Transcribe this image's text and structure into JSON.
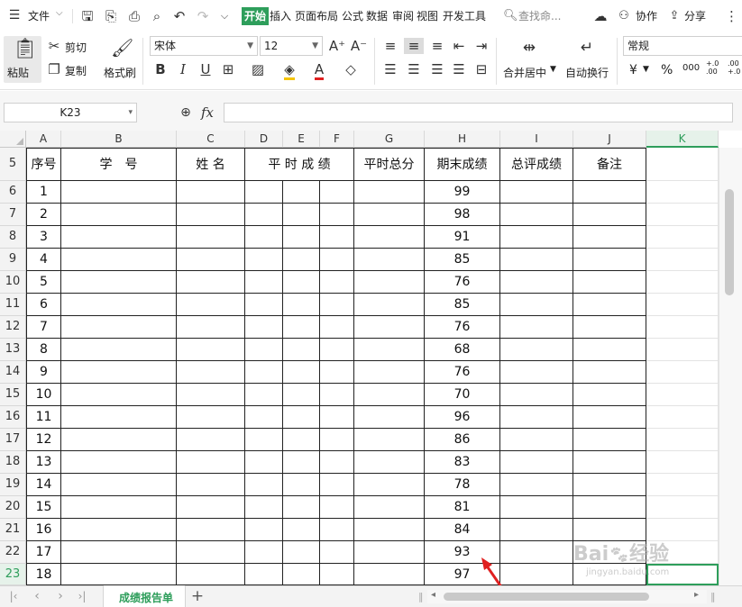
{
  "menu": {
    "file_label": "文件",
    "tabs": [
      "开始",
      "插入",
      "页面布局",
      "公式",
      "数据",
      "审阅",
      "视图",
      "开发工具"
    ],
    "search_placeholder": "查找命...",
    "collab_label": "协作",
    "share_label": "分享"
  },
  "ribbon": {
    "paste_label": "粘贴",
    "cut_label": "剪切",
    "copy_label": "复制",
    "format_painter_label": "格式刷",
    "font_name": "宋体",
    "font_size": "12",
    "merge_label": "合并居中",
    "wrap_label": "自动换行",
    "number_format": "常规",
    "currency_symbol": "¥",
    "percent_symbol": "%",
    "thousands_symbol": "000",
    "inc_decimal": "+.0 .00",
    "dec_decimal": ".00 +.0"
  },
  "formula_bar": {
    "name_box": "K23",
    "fx_label": "fx"
  },
  "columns": [
    "A",
    "B",
    "C",
    "D",
    "E",
    "F",
    "G",
    "H",
    "I",
    "J",
    "K"
  ],
  "header_row": {
    "row_num": "5",
    "seq": "序号",
    "student_id": "学　号",
    "name": "姓 名",
    "regular": "平 时 成 绩",
    "regular_total": "平时总分",
    "final": "期末成绩",
    "overall": "总评成绩",
    "note": "备注"
  },
  "rows": [
    {
      "row": "6",
      "seq": "1",
      "final": "99"
    },
    {
      "row": "7",
      "seq": "2",
      "final": "98"
    },
    {
      "row": "8",
      "seq": "3",
      "final": "91"
    },
    {
      "row": "9",
      "seq": "4",
      "final": "85"
    },
    {
      "row": "10",
      "seq": "5",
      "final": "76"
    },
    {
      "row": "11",
      "seq": "6",
      "final": "85"
    },
    {
      "row": "12",
      "seq": "7",
      "final": "76"
    },
    {
      "row": "13",
      "seq": "8",
      "final": "68"
    },
    {
      "row": "14",
      "seq": "9",
      "final": "76"
    },
    {
      "row": "15",
      "seq": "10",
      "final": "70"
    },
    {
      "row": "16",
      "seq": "11",
      "final": "96"
    },
    {
      "row": "17",
      "seq": "12",
      "final": "86"
    },
    {
      "row": "18",
      "seq": "13",
      "final": "83"
    },
    {
      "row": "19",
      "seq": "14",
      "final": "78"
    },
    {
      "row": "20",
      "seq": "15",
      "final": "81"
    },
    {
      "row": "21",
      "seq": "16",
      "final": "84"
    },
    {
      "row": "22",
      "seq": "17",
      "final": "93"
    },
    {
      "row": "23",
      "seq": "18",
      "final": "97"
    }
  ],
  "sheet_tab": "成绩报告单",
  "colors": {
    "accent": "#2e9e5b",
    "arrow": "#e02020",
    "grid": "#222222"
  }
}
